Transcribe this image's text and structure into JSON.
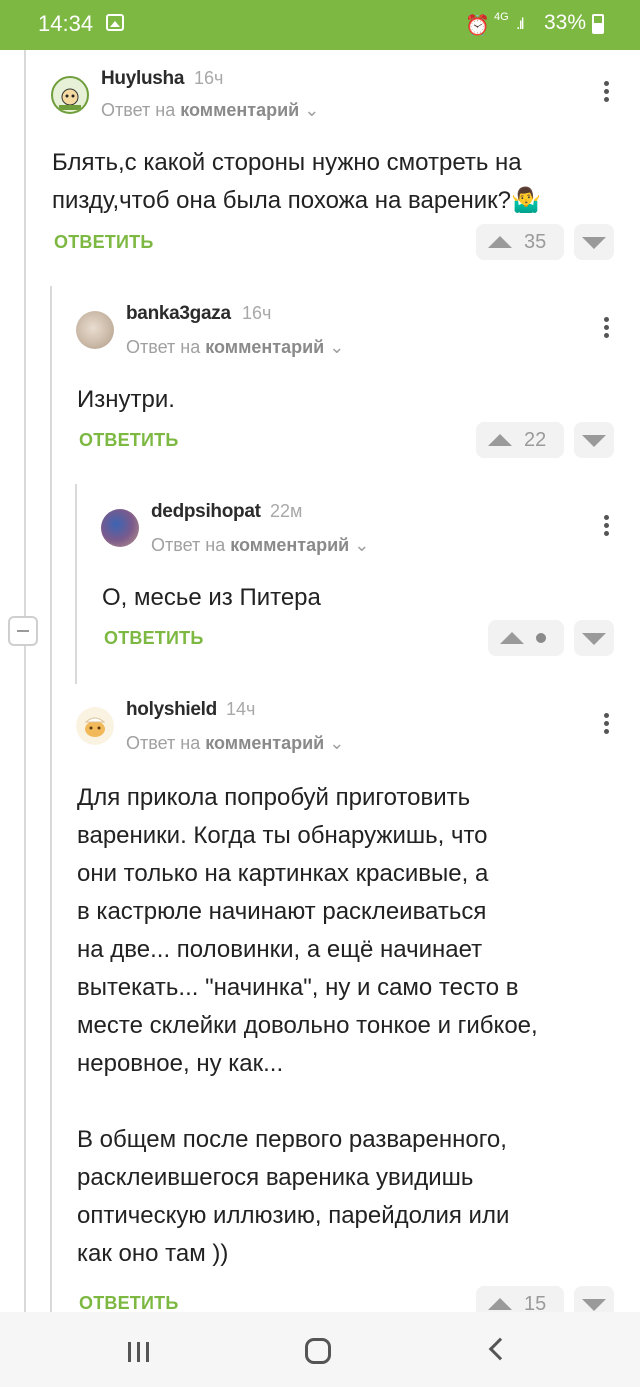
{
  "status_bar": {
    "time": "14:34",
    "network": "4G",
    "battery": "33%"
  },
  "comments": [
    {
      "username": "Huylusha",
      "time": "16ч",
      "reply_prefix": "Ответ на",
      "reply_target": "комментарий",
      "text": "Блять,с какой стороны нужно смотреть на пизду,чтоб она была похожа на вареник?🤷‍♂️",
      "reply_label": "ОТВЕТИТЬ",
      "rating": "35"
    },
    {
      "username": "banka3gaza",
      "time": "16ч",
      "reply_prefix": "Ответ на",
      "reply_target": "комментарий",
      "text": "Изнутри.",
      "reply_label": "ОТВЕТИТЬ",
      "rating": "22"
    },
    {
      "username": "dedpsihopat",
      "time": "22м",
      "reply_prefix": "Ответ на",
      "reply_target": "комментарий",
      "text": "О, месье из Питера",
      "reply_label": "ОТВЕТИТЬ",
      "rating": ""
    },
    {
      "username": "holyshield",
      "time": "14ч",
      "reply_prefix": "Ответ на",
      "reply_target": "комментарий",
      "text_lines": [
        "Для прикола попробуй приготовить",
        "вареники. Когда ты обнаружишь, что",
        "они только на картинках красивые, а",
        "в кастрюле начинают расклеиваться",
        "на две... половинки, а ещё начинает",
        "вытекать... \"начинка\", ну и само тесто в",
        "месте склейки довольно тонкое и гибкое,",
        "неровное, ну как...",
        "",
        "В общем после первого разваренного,",
        "расклеившегося вареника увидишь",
        "оптическую иллюзию, парейдолия или",
        "как оно там ))"
      ],
      "reply_label": "ОТВЕТИТЬ",
      "rating": "15"
    }
  ],
  "colors": {
    "accent": "#7cb842",
    "muted": "#a0a0a0"
  },
  "icons": [
    "image-icon",
    "alarm-icon",
    "signal-icon",
    "battery-icon",
    "more-vert-icon",
    "upvote-icon",
    "downvote-icon",
    "collapse-icon",
    "recent-apps-icon",
    "home-icon",
    "back-icon"
  ]
}
